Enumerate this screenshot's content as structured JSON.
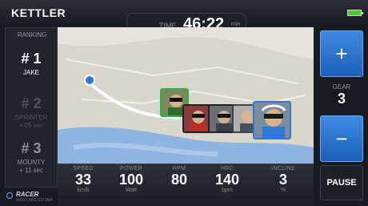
{
  "app": {
    "logo": "KETTLER"
  },
  "header": {
    "time_label": "TIME",
    "time_value": "46:22",
    "time_unit": "min"
  },
  "ranking": {
    "title": "RANKING",
    "items": [
      {
        "position": "# 1",
        "name": "JAKE",
        "gap": ""
      },
      {
        "position": "# 2",
        "name": "SPRINTER",
        "gap": "+ 05 sec"
      },
      {
        "position": "# 3",
        "name": "MOUNTY",
        "gap": "+ 11 sec"
      }
    ]
  },
  "controls": {
    "plus_label": "+",
    "gear_label": "GEAR",
    "gear_value": "3",
    "minus_label": "−",
    "pause_label": "PAUSE"
  },
  "metrics": [
    {
      "label": "SPEED",
      "value": "33",
      "unit": "km/h"
    },
    {
      "label": "POWER",
      "value": "100",
      "unit": "Watt"
    },
    {
      "label": "RPM",
      "value": "80",
      "unit": ""
    },
    {
      "label": "HRC",
      "value": "140",
      "unit": "bpm"
    },
    {
      "label": "INCLINE",
      "value": "3",
      "unit": "%"
    }
  ],
  "map": {
    "route_color": "#ffffff",
    "marker_color": "#2d77d6",
    "water_color": "#8fb4e0"
  },
  "brand": {
    "name": "RACER",
    "subtitle": "S4321 ABC 0173M4"
  },
  "colors": {
    "accent_blue": "#2d77d6",
    "battery_green": "#44cc33",
    "leader_green": "#2bb34a"
  }
}
